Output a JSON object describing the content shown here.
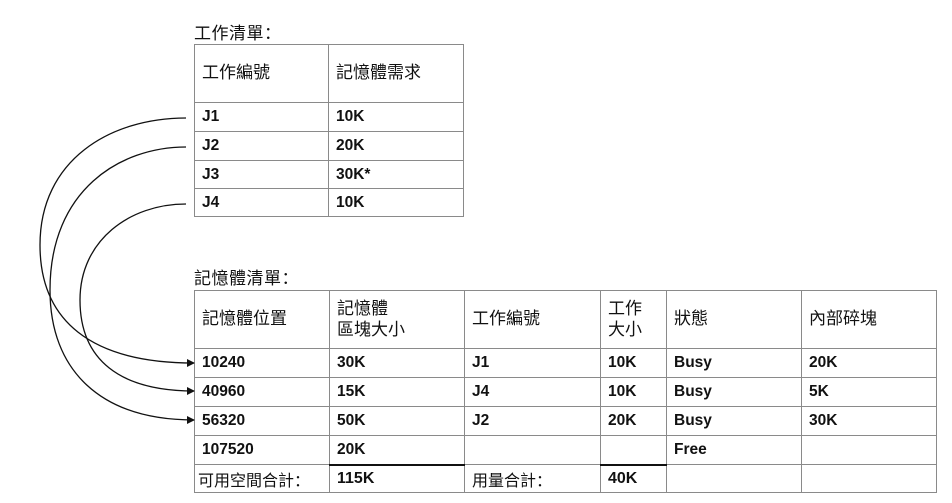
{
  "job_list": {
    "title": "工作清單：",
    "headers": [
      "工作編號",
      "記憶體需求"
    ],
    "rows": [
      {
        "job": "J1",
        "memory": "10K"
      },
      {
        "job": "J2",
        "memory": "20K"
      },
      {
        "job": "J3",
        "memory": "30K*"
      },
      {
        "job": "J4",
        "memory": "10K"
      }
    ]
  },
  "memory_list": {
    "title": "記憶體清單：",
    "headers": [
      "記憶體位置",
      "記憶體\n區塊大小",
      "工作編號",
      "工作\n大小",
      "狀態",
      "內部碎塊"
    ],
    "rows": [
      {
        "location": "10240",
        "block_size": "30K",
        "job": "J1",
        "job_size": "10K",
        "status": "Busy",
        "fragment": "20K"
      },
      {
        "location": "40960",
        "block_size": "15K",
        "job": "J4",
        "job_size": "10K",
        "status": "Busy",
        "fragment": "5K"
      },
      {
        "location": "56320",
        "block_size": "50K",
        "job": "J2",
        "job_size": "20K",
        "status": "Busy",
        "fragment": "30K"
      },
      {
        "location": "107520",
        "block_size": "20K",
        "job": "",
        "job_size": "",
        "status": "Free",
        "fragment": ""
      }
    ],
    "footer": {
      "available_label": "可用空間合計：",
      "available_value": "115K",
      "used_label": "用量合計：",
      "used_value": "40K"
    }
  }
}
